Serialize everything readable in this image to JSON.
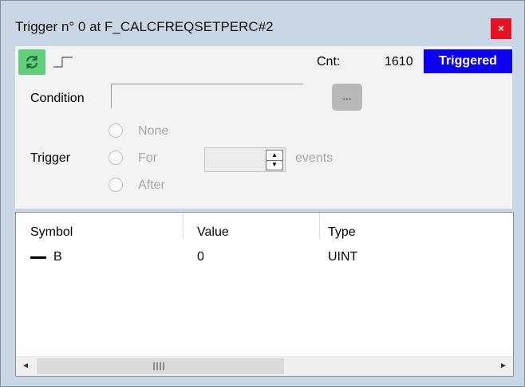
{
  "window": {
    "title": "Trigger n° 0 at F_CALCFREQSETPERC#2",
    "close_glyph": "×"
  },
  "toolbar": {
    "refresh_icon": "refresh-icon",
    "edge_icon": "rising-edge-icon",
    "count_label": "Cnt:",
    "count_value": "1610",
    "status": "Triggered",
    "status_color": "#0d00f2"
  },
  "condition": {
    "label": "Condition",
    "value": "",
    "browse_label": "..."
  },
  "trigger": {
    "label": "Trigger",
    "options": [
      {
        "label": "None",
        "selected": false
      },
      {
        "label": "For",
        "selected": false
      },
      {
        "label": "After",
        "selected": false
      }
    ],
    "count_value": "",
    "events_label": "events",
    "enabled": false
  },
  "table": {
    "columns": [
      "Symbol",
      "Value",
      "Type"
    ],
    "rows": [
      {
        "symbol": "B",
        "value": "0",
        "type": "UINT"
      }
    ]
  },
  "scrollbar": {
    "left_arrow": "◄",
    "right_arrow": "►"
  }
}
